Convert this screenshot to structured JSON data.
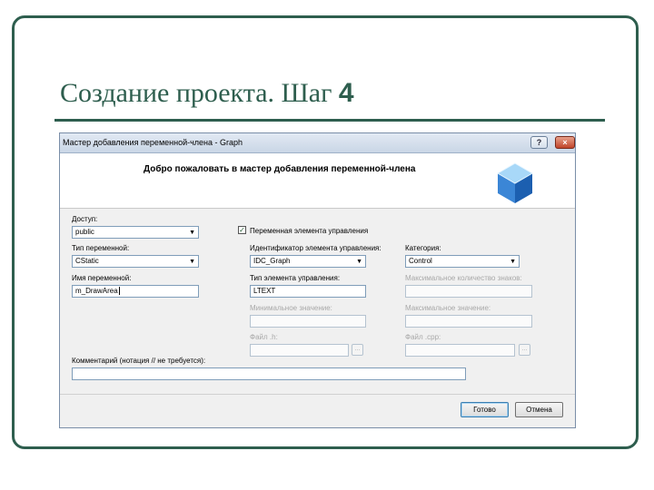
{
  "slide": {
    "title_text": "Создание проекта. Шаг ",
    "title_step": "4"
  },
  "dialog": {
    "title": "Мастер добавления переменной-члена - Graph",
    "help_button": "?",
    "close_button": "×",
    "welcome": "Добро пожаловать в мастер добавления переменной-члена",
    "access_label": "Доступ:",
    "access_value": "public",
    "control_variable_label": "Переменная элемента управления",
    "control_variable_checked": true,
    "var_type_label": "Тип переменной:",
    "var_type_value": "CStatic",
    "control_id_label": "Идентификатор элемента управления:",
    "control_id_value": "IDC_Graph",
    "category_label": "Категория:",
    "category_value": "Control",
    "var_name_label": "Имя переменной:",
    "var_name_value": "m_DrawArea",
    "control_type_label": "Тип элемента управления:",
    "control_type_value": "LTEXT",
    "max_chars_label": "Максимальное количество знаков:",
    "min_value_label": "Минимальное значение:",
    "max_value_label": "Максимальное значение:",
    "h_file_label": "Файл .h:",
    "cpp_file_label": "Файл .cpp:",
    "browse_label": "...",
    "comment_label": "Комментарий (нотация // не требуется):",
    "comment_value": "",
    "finish_button": "Готово",
    "cancel_button": "Отмена"
  },
  "colors": {
    "accent": "#2e5e4e"
  }
}
